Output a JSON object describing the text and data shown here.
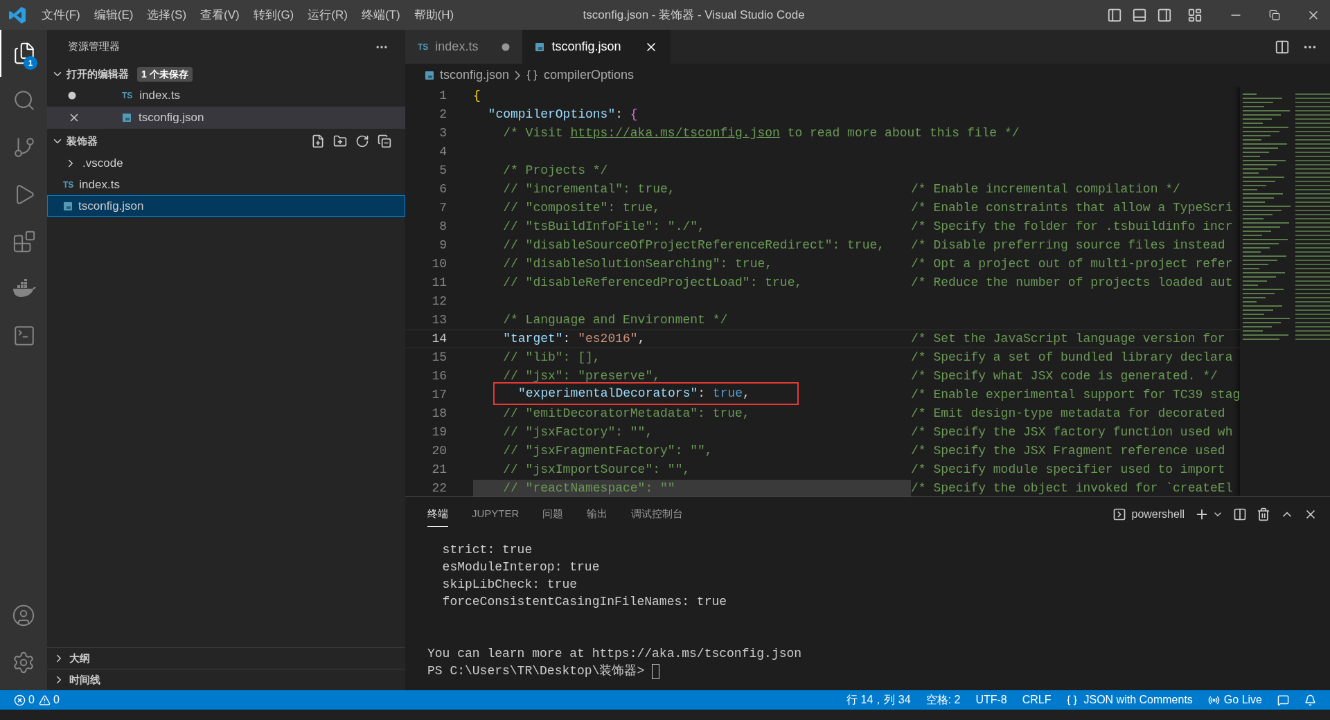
{
  "title_bar": {
    "menu": [
      "文件(F)",
      "编辑(E)",
      "选择(S)",
      "查看(V)",
      "转到(G)",
      "运行(R)",
      "终端(T)",
      "帮助(H)"
    ],
    "title": "tsconfig.json - 装饰器 - Visual Studio Code"
  },
  "activity_bar": {
    "items": [
      {
        "kind": "explorer",
        "selected": true,
        "badge": "1"
      },
      {
        "kind": "search",
        "selected": false
      },
      {
        "kind": "source_control",
        "selected": false
      },
      {
        "kind": "run_debug",
        "selected": false
      },
      {
        "kind": "extensions",
        "selected": false
      },
      {
        "kind": "docker",
        "selected": false
      },
      {
        "kind": "terminal",
        "selected": false
      }
    ],
    "bottom": [
      {
        "kind": "account"
      },
      {
        "kind": "settings"
      }
    ]
  },
  "sidebar": {
    "title": "资源管理器",
    "open_editors": {
      "label": "打开的编辑器",
      "expanded": true,
      "badge": "1 个未保存",
      "items": [
        {
          "name": "index.ts",
          "kind": "ts",
          "type_label": "TS",
          "dirty": true,
          "selected": false
        },
        {
          "name": "tsconfig.json",
          "kind": "json",
          "dirty": false,
          "selected": true
        }
      ]
    },
    "folder": {
      "label": "装饰器",
      "expanded": true,
      "items": [
        {
          "name": ".vscode",
          "kind": "folder",
          "expanded": false,
          "selected": false
        },
        {
          "name": "index.ts",
          "kind": "ts",
          "type_label": "TS",
          "selected": false
        },
        {
          "name": "tsconfig.json",
          "kind": "json",
          "selected": true
        }
      ]
    },
    "collapsed_sections": [
      {
        "label": "大纲",
        "expanded": false
      },
      {
        "label": "时间线",
        "expanded": false
      }
    ]
  },
  "tabs": [
    {
      "name": "index.ts",
      "kind": "ts",
      "type_label": "TS",
      "dirty": true,
      "selected": false
    },
    {
      "name": "tsconfig.json",
      "kind": "json",
      "dirty": false,
      "selected": true
    }
  ],
  "breadcrumbs": [
    {
      "kind": "json",
      "text": "tsconfig.json"
    },
    {
      "kind": "object",
      "text": "compilerOptions"
    }
  ],
  "code_lines": [
    {
      "number": "1",
      "tokens": [
        {
          "kind": "brace",
          "t": "{"
        }
      ]
    },
    {
      "number": "2",
      "tokens": [
        {
          "kind": "key",
          "t": "  \"compilerOptions\""
        },
        {
          "kind": "punct",
          "t": ": "
        },
        {
          "kind": "brace2",
          "t": "{"
        }
      ]
    },
    {
      "number": "3",
      "tokens": [
        {
          "kind": "comment",
          "t": "    /* Visit "
        },
        {
          "kind": "link",
          "t": "https://aka.ms/tsconfig.json"
        },
        {
          "kind": "comment",
          "t": " to read more about this file */"
        }
      ]
    },
    {
      "number": "4"
    },
    {
      "number": "5",
      "tokens": [
        {
          "kind": "comment",
          "t": "    /* Projects */"
        }
      ]
    },
    {
      "number": "6",
      "tokens": [
        {
          "kind": "comment",
          "t": "    // \"incremental\": true,"
        }
      ],
      "comment": "/* Enable incremental compilation */"
    },
    {
      "number": "7",
      "tokens": [
        {
          "kind": "comment",
          "t": "    // \"composite\": true,"
        }
      ],
      "comment": "/* Enable constraints that allow a TypeScri"
    },
    {
      "number": "8",
      "tokens": [
        {
          "kind": "comment",
          "t": "    // \"tsBuildInfoFile\": \"./\","
        }
      ],
      "comment": "/* Specify the folder for .tsbuildinfo incr"
    },
    {
      "number": "9",
      "tokens": [
        {
          "kind": "comment",
          "t": "    // \"disableSourceOfProjectReferenceRedirect\": true,"
        }
      ],
      "comment": "/* Disable preferring source files instead"
    },
    {
      "number": "10",
      "tokens": [
        {
          "kind": "comment",
          "t": "    // \"disableSolutionSearching\": true,"
        }
      ],
      "comment": "/* Opt a project out of multi-project refer"
    },
    {
      "number": "11",
      "tokens": [
        {
          "kind": "comment",
          "t": "    // \"disableReferencedProjectLoad\": true,"
        }
      ],
      "comment": "/* Reduce the number of projects loaded aut"
    },
    {
      "number": "12"
    },
    {
      "number": "13",
      "tokens": [
        {
          "kind": "comment",
          "t": "    /* Language and Environment */"
        }
      ]
    },
    {
      "number": "14",
      "current": true,
      "tokens": [
        {
          "kind": "key",
          "t": "    \"target\""
        },
        {
          "kind": "punct",
          "t": ": "
        },
        {
          "kind": "string",
          "t": "\"es2016\""
        },
        {
          "kind": "punct",
          "t": ","
        }
      ],
      "comment": "/* Set the JavaScript language version for"
    },
    {
      "number": "15",
      "tokens": [
        {
          "kind": "comment",
          "t": "    // \"lib\": [],"
        }
      ],
      "comment": "/* Specify a set of bundled library declara"
    },
    {
      "number": "16",
      "tokens": [
        {
          "kind": "comment",
          "t": "    // \"jsx\": \"preserve\","
        }
      ],
      "comment": "/* Specify what JSX code is generated. */"
    },
    {
      "number": "17",
      "boxed": true,
      "tokens": [
        {
          "kind": "key",
          "t": "      \"experimentalDecorators\""
        },
        {
          "kind": "punct",
          "t": ": "
        },
        {
          "kind": "boolean",
          "t": "true"
        },
        {
          "kind": "punct",
          "t": ","
        }
      ],
      "comment": "/* Enable experimental support for TC39 stag"
    },
    {
      "number": "18",
      "tokens": [
        {
          "kind": "comment",
          "t": "    // \"emitDecoratorMetadata\": true,"
        }
      ],
      "comment": "/* Emit design-type metadata for decorated"
    },
    {
      "number": "19",
      "tokens": [
        {
          "kind": "comment",
          "t": "    // \"jsxFactory\": \"\","
        }
      ],
      "comment": "/* Specify the JSX factory function used wh"
    },
    {
      "number": "20",
      "tokens": [
        {
          "kind": "comment",
          "t": "    // \"jsxFragmentFactory\": \"\","
        }
      ],
      "comment": "/* Specify the JSX Fragment reference used"
    },
    {
      "number": "21",
      "tokens": [
        {
          "kind": "comment",
          "t": "    // \"jsxImportSource\": \"\","
        }
      ],
      "comment": "/* Specify module specifier used to import"
    },
    {
      "number": "22",
      "highlighted": true,
      "tokens": [
        {
          "kind": "comment",
          "t": "    // \"reactNamespace\": \"\""
        }
      ],
      "comment": "/* Specify the object invoked for `createEl"
    }
  ],
  "panel": {
    "tabs": [
      {
        "label": "终端",
        "selected": true
      },
      {
        "label": "JUPYTER",
        "selected": false
      },
      {
        "label": "问题",
        "selected": false
      },
      {
        "label": "输出",
        "selected": false
      },
      {
        "label": "调试控制台",
        "selected": false
      }
    ],
    "shell": "powershell",
    "terminal_lines": [
      "  strict: true",
      "  esModuleInterop: true",
      "  skipLibCheck: true",
      "  forceConsistentCasingInFileNames: true"
    ],
    "terminal_footer": "You can learn more at https://aka.ms/tsconfig.json",
    "prompt": "PS C:\\Users\\TR\\Desktop\\装饰器> "
  },
  "status_bar": {
    "errors": "0",
    "warnings": "0",
    "position": "行 14，列 34",
    "indent": "空格: 2",
    "encoding": "UTF-8",
    "eol": "CRLF",
    "language": "JSON with Comments",
    "live": "Go Live"
  }
}
